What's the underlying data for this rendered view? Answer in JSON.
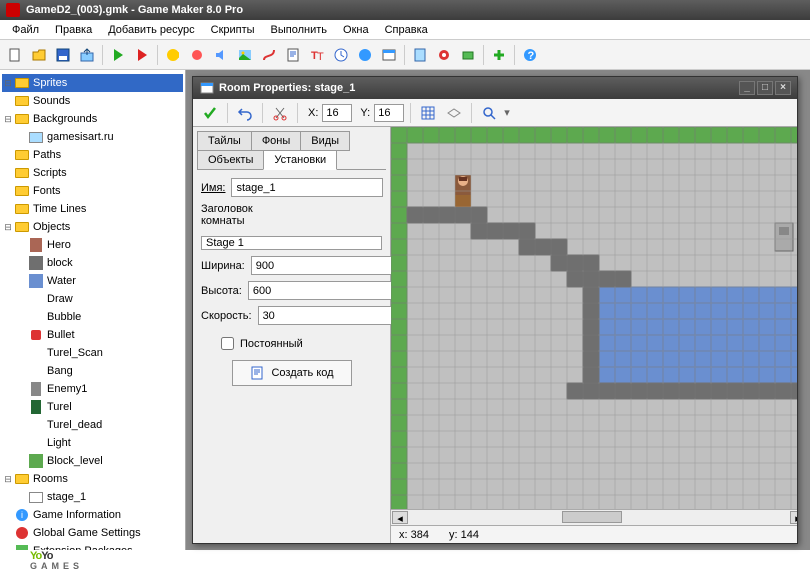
{
  "window": {
    "title": "GameD2_(003).gmk - Game Maker 8.0 Pro"
  },
  "menu": [
    "Файл",
    "Правка",
    "Добавить ресурс",
    "Скрипты",
    "Выполнить",
    "Окна",
    "Справка"
  ],
  "toolbar_icons": [
    "new",
    "open",
    "save",
    "export",
    "run",
    "run-debug",
    "play",
    "stop",
    "pacman",
    "sprite",
    "sound",
    "background",
    "path",
    "script",
    "shader",
    "font",
    "timeline",
    "text",
    "object",
    "room",
    "palette",
    "settings",
    "extension",
    "plus",
    "help"
  ],
  "tree": [
    {
      "label": "Sprites",
      "lvl": 0,
      "exp": "-",
      "sel": true,
      "icon": "folder"
    },
    {
      "label": "Sounds",
      "lvl": 0,
      "exp": " ",
      "icon": "folder"
    },
    {
      "label": "Backgrounds",
      "lvl": 0,
      "exp": "-",
      "icon": "folder"
    },
    {
      "label": "gamesisart.ru",
      "lvl": 1,
      "exp": " ",
      "icon": "bg"
    },
    {
      "label": "Paths",
      "lvl": 0,
      "exp": " ",
      "icon": "folder"
    },
    {
      "label": "Scripts",
      "lvl": 0,
      "exp": " ",
      "icon": "folder"
    },
    {
      "label": "Fonts",
      "lvl": 0,
      "exp": " ",
      "icon": "folder"
    },
    {
      "label": "Time Lines",
      "lvl": 0,
      "exp": " ",
      "icon": "folder"
    },
    {
      "label": "Objects",
      "lvl": 0,
      "exp": "-",
      "icon": "folder"
    },
    {
      "label": "Hero",
      "lvl": 1,
      "icon": "obj-hero"
    },
    {
      "label": "block",
      "lvl": 1,
      "icon": "obj-block"
    },
    {
      "label": "Water",
      "lvl": 1,
      "icon": "obj-water"
    },
    {
      "label": "Draw",
      "lvl": 1,
      "icon": "obj"
    },
    {
      "label": "Bubble",
      "lvl": 1,
      "icon": "obj"
    },
    {
      "label": "Bullet",
      "lvl": 1,
      "icon": "obj-bullet"
    },
    {
      "label": "Turel_Scan",
      "lvl": 1,
      "icon": "obj"
    },
    {
      "label": "Bang",
      "lvl": 1,
      "icon": "obj"
    },
    {
      "label": "Enemy1",
      "lvl": 1,
      "icon": "obj-enemy"
    },
    {
      "label": "Turel",
      "lvl": 1,
      "icon": "obj-turel"
    },
    {
      "label": "Turel_dead",
      "lvl": 1,
      "icon": "obj"
    },
    {
      "label": "Light",
      "lvl": 1,
      "icon": "obj"
    },
    {
      "label": "Block_level",
      "lvl": 1,
      "icon": "obj-green"
    },
    {
      "label": "Rooms",
      "lvl": 0,
      "exp": "-",
      "icon": "folder"
    },
    {
      "label": "stage_1",
      "lvl": 1,
      "icon": "room"
    },
    {
      "label": "Game Information",
      "lvl": 0,
      "icon": "info"
    },
    {
      "label": "Global Game Settings",
      "lvl": 0,
      "icon": "settings"
    },
    {
      "label": "Extension Packages",
      "lvl": 0,
      "icon": "ext"
    }
  ],
  "room_window": {
    "title": "Room Properties: stage_1",
    "snap": {
      "x_label": "X:",
      "x": "16",
      "y_label": "Y:",
      "y": "16"
    },
    "tabs": {
      "t1": "Тайлы",
      "t2": "Фоны",
      "t3": "Виды",
      "t4": "Объекты",
      "t5": "Установки"
    },
    "props": {
      "name_label": "Имя:",
      "name": "stage_1",
      "caption_label": "Заголовок комнаты",
      "caption": "Stage 1",
      "width_label": "Ширина:",
      "width": "900",
      "height_label": "Высота:",
      "height": "600",
      "speed_label": "Скорость:",
      "speed": "30",
      "persistent_label": "Постоянный",
      "code_btn": "Создать код"
    },
    "status": {
      "x_label": "x:",
      "x": "384",
      "y_label": "y:",
      "y": "144"
    }
  },
  "footer": {
    "brand1": "YoYo",
    "brand2": "GAMES"
  },
  "colors": {
    "green": "#5da94f",
    "block": "#6f6f6f",
    "water": "#6a8fd0",
    "bg": "#c0c0c0"
  }
}
